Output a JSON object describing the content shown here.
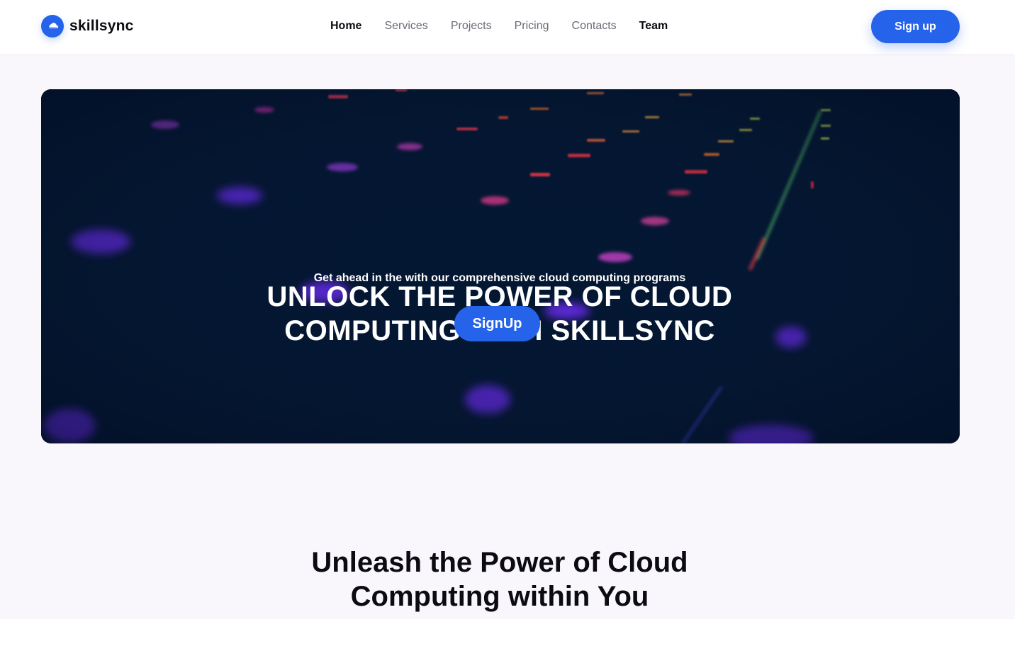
{
  "brand": {
    "name": "skillsync",
    "logo_icon": "cloud-icon",
    "accent": "#2563eb"
  },
  "nav": {
    "links": [
      {
        "label": "Home"
      },
      {
        "label": "Services"
      },
      {
        "label": "Projects"
      },
      {
        "label": "Pricing"
      },
      {
        "label": "Contacts"
      },
      {
        "label": "Team"
      }
    ],
    "signup_label": "Sign up"
  },
  "hero": {
    "title_line1": "UNLOCK THE POWER OF CLOUD",
    "title_line2": "COMPUTING WITH SKILLSYNC",
    "subtitle": "Get ahead in the with our comprehensive cloud computing programs",
    "cta_label": "SignUp",
    "background_color": "#041732"
  },
  "section": {
    "title_line1": "Unleash the Power of Cloud",
    "title_line2": "Computing within You"
  }
}
